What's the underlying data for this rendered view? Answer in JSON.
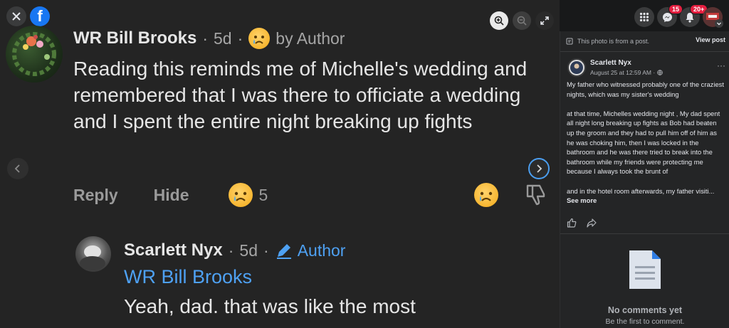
{
  "photo": {
    "comment1": {
      "author": "WR Bill Brooks",
      "time": "5d",
      "author_tag": "by Author",
      "text": "Reading this reminds me of Michelle's wedding and remembered that I  was there to officiate a wedding and I spent the entire night breaking up fights",
      "reply_label": "Reply",
      "hide_label": "Hide",
      "reaction_count": "5"
    },
    "comment2": {
      "author": "Scarlett Nyx",
      "time": "5d",
      "author_tag": "Author",
      "reply_to": "WR Bill Brooks",
      "text": "Yeah, dad.  that was like the most"
    }
  },
  "header": {
    "messenger_badge": "15",
    "notifications_badge": "20+"
  },
  "sidebar": {
    "notice": "This photo is from a post.",
    "view_post": "View post",
    "post": {
      "author": "Scarlett Nyx",
      "time": "August 25 at 12:59 AM · ",
      "para1": "My father who witnessed probably one of the craziest nights, which was my sister's wedding",
      "para2": "at that time, Michelles wedding night , My dad spent all night long breaking up fights as Bob had beaten up the groom and they had to pull him off of him as he was choking him, then I was locked in the bathroom and he was there tried to break into the bathroom while my friends were protecting me because I always took the brunt of",
      "para3": "and in the hotel room afterwards, my father visiti... ",
      "see_more": "See more"
    },
    "no_comments": "No comments yet",
    "be_first": "Be the first to comment."
  }
}
